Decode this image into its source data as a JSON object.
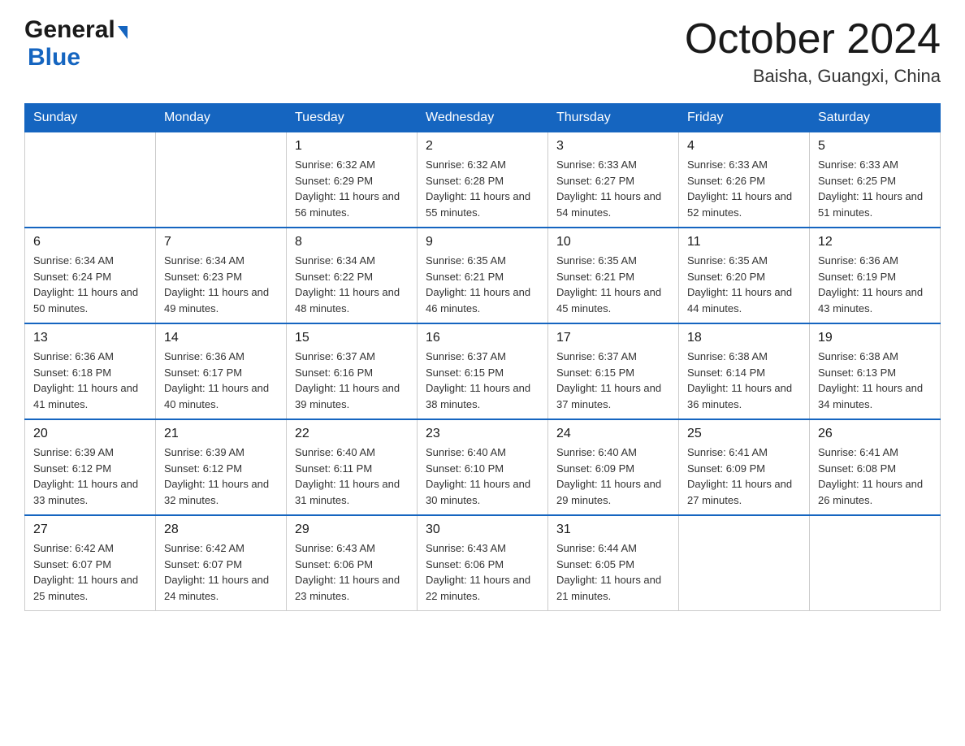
{
  "header": {
    "logo_general": "General",
    "logo_blue": "Blue",
    "month": "October 2024",
    "location": "Baisha, Guangxi, China"
  },
  "weekdays": [
    "Sunday",
    "Monday",
    "Tuesday",
    "Wednesday",
    "Thursday",
    "Friday",
    "Saturday"
  ],
  "weeks": [
    [
      {
        "day": "",
        "info": ""
      },
      {
        "day": "",
        "info": ""
      },
      {
        "day": "1",
        "info": "Sunrise: 6:32 AM\nSunset: 6:29 PM\nDaylight: 11 hours and 56 minutes."
      },
      {
        "day": "2",
        "info": "Sunrise: 6:32 AM\nSunset: 6:28 PM\nDaylight: 11 hours and 55 minutes."
      },
      {
        "day": "3",
        "info": "Sunrise: 6:33 AM\nSunset: 6:27 PM\nDaylight: 11 hours and 54 minutes."
      },
      {
        "day": "4",
        "info": "Sunrise: 6:33 AM\nSunset: 6:26 PM\nDaylight: 11 hours and 52 minutes."
      },
      {
        "day": "5",
        "info": "Sunrise: 6:33 AM\nSunset: 6:25 PM\nDaylight: 11 hours and 51 minutes."
      }
    ],
    [
      {
        "day": "6",
        "info": "Sunrise: 6:34 AM\nSunset: 6:24 PM\nDaylight: 11 hours and 50 minutes."
      },
      {
        "day": "7",
        "info": "Sunrise: 6:34 AM\nSunset: 6:23 PM\nDaylight: 11 hours and 49 minutes."
      },
      {
        "day": "8",
        "info": "Sunrise: 6:34 AM\nSunset: 6:22 PM\nDaylight: 11 hours and 48 minutes."
      },
      {
        "day": "9",
        "info": "Sunrise: 6:35 AM\nSunset: 6:21 PM\nDaylight: 11 hours and 46 minutes."
      },
      {
        "day": "10",
        "info": "Sunrise: 6:35 AM\nSunset: 6:21 PM\nDaylight: 11 hours and 45 minutes."
      },
      {
        "day": "11",
        "info": "Sunrise: 6:35 AM\nSunset: 6:20 PM\nDaylight: 11 hours and 44 minutes."
      },
      {
        "day": "12",
        "info": "Sunrise: 6:36 AM\nSunset: 6:19 PM\nDaylight: 11 hours and 43 minutes."
      }
    ],
    [
      {
        "day": "13",
        "info": "Sunrise: 6:36 AM\nSunset: 6:18 PM\nDaylight: 11 hours and 41 minutes."
      },
      {
        "day": "14",
        "info": "Sunrise: 6:36 AM\nSunset: 6:17 PM\nDaylight: 11 hours and 40 minutes."
      },
      {
        "day": "15",
        "info": "Sunrise: 6:37 AM\nSunset: 6:16 PM\nDaylight: 11 hours and 39 minutes."
      },
      {
        "day": "16",
        "info": "Sunrise: 6:37 AM\nSunset: 6:15 PM\nDaylight: 11 hours and 38 minutes."
      },
      {
        "day": "17",
        "info": "Sunrise: 6:37 AM\nSunset: 6:15 PM\nDaylight: 11 hours and 37 minutes."
      },
      {
        "day": "18",
        "info": "Sunrise: 6:38 AM\nSunset: 6:14 PM\nDaylight: 11 hours and 36 minutes."
      },
      {
        "day": "19",
        "info": "Sunrise: 6:38 AM\nSunset: 6:13 PM\nDaylight: 11 hours and 34 minutes."
      }
    ],
    [
      {
        "day": "20",
        "info": "Sunrise: 6:39 AM\nSunset: 6:12 PM\nDaylight: 11 hours and 33 minutes."
      },
      {
        "day": "21",
        "info": "Sunrise: 6:39 AM\nSunset: 6:12 PM\nDaylight: 11 hours and 32 minutes."
      },
      {
        "day": "22",
        "info": "Sunrise: 6:40 AM\nSunset: 6:11 PM\nDaylight: 11 hours and 31 minutes."
      },
      {
        "day": "23",
        "info": "Sunrise: 6:40 AM\nSunset: 6:10 PM\nDaylight: 11 hours and 30 minutes."
      },
      {
        "day": "24",
        "info": "Sunrise: 6:40 AM\nSunset: 6:09 PM\nDaylight: 11 hours and 29 minutes."
      },
      {
        "day": "25",
        "info": "Sunrise: 6:41 AM\nSunset: 6:09 PM\nDaylight: 11 hours and 27 minutes."
      },
      {
        "day": "26",
        "info": "Sunrise: 6:41 AM\nSunset: 6:08 PM\nDaylight: 11 hours and 26 minutes."
      }
    ],
    [
      {
        "day": "27",
        "info": "Sunrise: 6:42 AM\nSunset: 6:07 PM\nDaylight: 11 hours and 25 minutes."
      },
      {
        "day": "28",
        "info": "Sunrise: 6:42 AM\nSunset: 6:07 PM\nDaylight: 11 hours and 24 minutes."
      },
      {
        "day": "29",
        "info": "Sunrise: 6:43 AM\nSunset: 6:06 PM\nDaylight: 11 hours and 23 minutes."
      },
      {
        "day": "30",
        "info": "Sunrise: 6:43 AM\nSunset: 6:06 PM\nDaylight: 11 hours and 22 minutes."
      },
      {
        "day": "31",
        "info": "Sunrise: 6:44 AM\nSunset: 6:05 PM\nDaylight: 11 hours and 21 minutes."
      },
      {
        "day": "",
        "info": ""
      },
      {
        "day": "",
        "info": ""
      }
    ]
  ]
}
